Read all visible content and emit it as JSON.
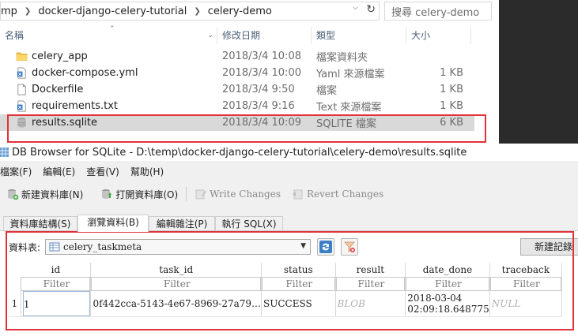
{
  "explorer": {
    "breadcrumb": [
      "mp",
      "docker-django-celery-tutorial",
      "celery-demo"
    ],
    "search_placeholder": "搜尋 celery-demo",
    "columns": [
      "名稱",
      "修改日期",
      "類型",
      "大小"
    ],
    "files": [
      {
        "name": "celery_app",
        "date": "2018/3/4 10:08",
        "type": "檔案資料夾",
        "size": "",
        "icon": "folder-icon"
      },
      {
        "name": "docker-compose.yml",
        "date": "2018/3/4 10:00",
        "type": "Yaml 來源檔案",
        "size": "1 KB",
        "icon": "yaml-file-icon"
      },
      {
        "name": "Dockerfile",
        "date": "2018/3/4 9:50",
        "type": "檔案",
        "size": "1 KB",
        "icon": "blank-file-icon"
      },
      {
        "name": "requirements.txt",
        "date": "2018/3/4 9:16",
        "type": "Text 來源檔案",
        "size": "1 KB",
        "icon": "text-file-icon"
      },
      {
        "name": "results.sqlite",
        "date": "2018/3/4 10:09",
        "type": "SQLITE 檔案",
        "size": "6 KB",
        "icon": "database-file-icon"
      }
    ],
    "highlight_color": "#e0323a"
  },
  "db": {
    "title": "DB Browser for SQLite - D:\\temp\\docker-django-celery-tutorial\\celery-demo\\results.sqlite",
    "menu": [
      "檔案(F)",
      "編輯(E)",
      "查看(V)",
      "幫助(H)"
    ],
    "toolbar": {
      "new_db": "新建資料庫(N)",
      "open_db": "打開資料庫(O)",
      "write_changes": "Write Changes",
      "revert_changes": "Revert Changes"
    },
    "tabs": [
      "資料庫結構(S)",
      "瀏覽資料(B)",
      "編輯雜注(P)",
      "執行 SQL(X)"
    ],
    "browse": {
      "table_label": "資料表:",
      "table_selected": "celery_taskmeta",
      "new_record": "新建記錄",
      "columns": [
        "id",
        "task_id",
        "status",
        "result",
        "date_done",
        "traceback"
      ],
      "filter_placeholder": "Filter",
      "rows": [
        {
          "rownum": "1",
          "id": "1",
          "task_id": "0f442cca-5143-4e67-8969-27a79…",
          "status": "SUCCESS",
          "result": "BLOB",
          "date_done_1": "2018-03-04",
          "date_done_2": "02:09:18.648775",
          "traceback": "NULL"
        }
      ]
    }
  }
}
